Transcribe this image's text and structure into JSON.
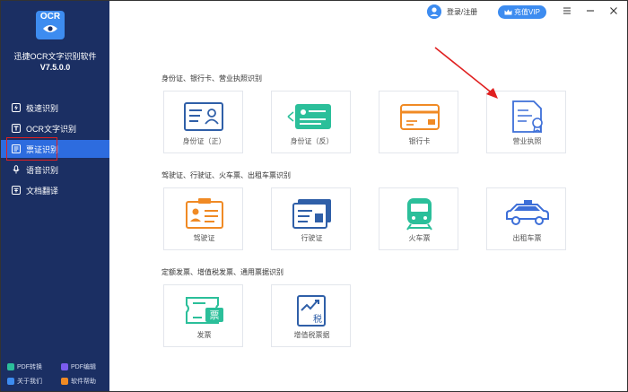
{
  "app": {
    "logo_text": "OCR",
    "name": "迅捷OCR文字识别软件",
    "version": "V7.5.0.0"
  },
  "sidebar": {
    "items": [
      {
        "label": "极速识别",
        "icon": "lightning-icon"
      },
      {
        "label": "OCR文字识别",
        "icon": "text-scan-icon"
      },
      {
        "label": "票证识别",
        "icon": "ticket-icon",
        "active": true
      },
      {
        "label": "语音识别",
        "icon": "microphone-icon"
      },
      {
        "label": "文档翻译",
        "icon": "translate-icon"
      }
    ],
    "bottom": {
      "pdf_convert": "PDF转换",
      "pdf_edit": "PDF编辑",
      "about": "关于我们",
      "help": "软件帮助"
    }
  },
  "topbar": {
    "login": "登录/注册",
    "vip": "充值VIP"
  },
  "sections": [
    {
      "title": "身份证、银行卡、营业执照识别",
      "cards": [
        {
          "label": "身份证（正）",
          "icon": "id-card-front-icon"
        },
        {
          "label": "身份证（反）",
          "icon": "id-card-back-icon"
        },
        {
          "label": "银行卡",
          "icon": "bank-card-icon"
        },
        {
          "label": "营业执照",
          "icon": "business-license-icon"
        }
      ]
    },
    {
      "title": "驾驶证、行驶证、火车票、出租车票识别",
      "cards": [
        {
          "label": "驾驶证",
          "icon": "driver-license-icon"
        },
        {
          "label": "行驶证",
          "icon": "vehicle-license-icon"
        },
        {
          "label": "火车票",
          "icon": "train-icon"
        },
        {
          "label": "出租车票",
          "icon": "taxi-icon"
        }
      ]
    },
    {
      "title": "定额发票、增值税发票、通用票据识别",
      "cards": [
        {
          "label": "发票",
          "icon": "invoice-icon",
          "glyph": "票"
        },
        {
          "label": "增值税票据",
          "icon": "vat-invoice-icon",
          "glyph": "税"
        }
      ]
    }
  ],
  "colors": {
    "sidebar_bg": "#1b2f63",
    "accent": "#3d8cf0",
    "active_item": "#2d6cdf",
    "highlight_red": "#e02020",
    "id_blue": "#2f5fa8",
    "orange": "#f08a24",
    "green": "#2bbf9a"
  }
}
